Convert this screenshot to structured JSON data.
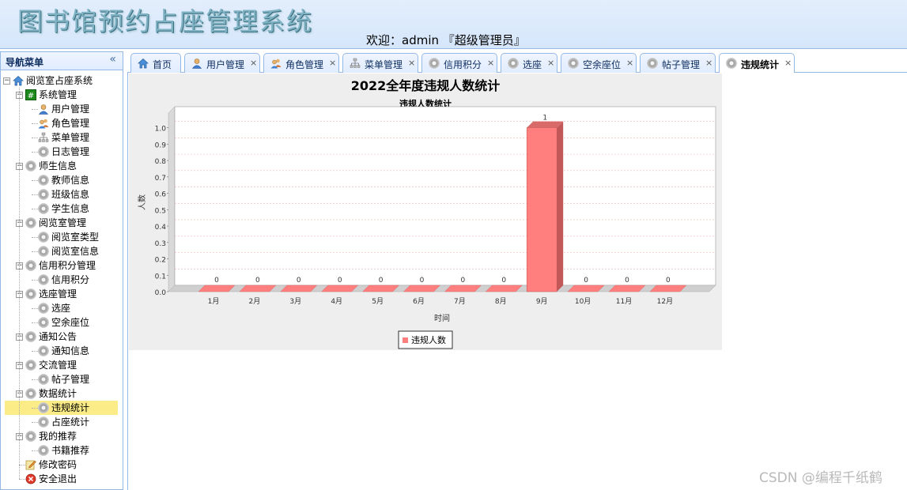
{
  "header": {
    "app_title": "图书馆预约占座管理系统",
    "welcome": "欢迎：admin 『超级管理员』"
  },
  "sidebar": {
    "title": "导航菜单",
    "tree": [
      {
        "label": "阅览室占座系统",
        "level": 0,
        "icon": "home-icon",
        "toggle": "minus"
      },
      {
        "label": "系统管理",
        "level": 1,
        "icon": "grid-icon",
        "toggle": "minus"
      },
      {
        "label": "用户管理",
        "level": 2,
        "icon": "user-icon"
      },
      {
        "label": "角色管理",
        "level": 2,
        "icon": "users-icon"
      },
      {
        "label": "菜单管理",
        "level": 2,
        "icon": "sitemap-icon"
      },
      {
        "label": "日志管理",
        "level": 2,
        "icon": "gear-icon"
      },
      {
        "label": "师生信息",
        "level": 1,
        "icon": "gear-icon",
        "toggle": "minus"
      },
      {
        "label": "教师信息",
        "level": 2,
        "icon": "gear-icon"
      },
      {
        "label": "班级信息",
        "level": 2,
        "icon": "gear-icon"
      },
      {
        "label": "学生信息",
        "level": 2,
        "icon": "gear-icon"
      },
      {
        "label": "阅览室管理",
        "level": 1,
        "icon": "gear-icon",
        "toggle": "minus"
      },
      {
        "label": "阅览室类型",
        "level": 2,
        "icon": "gear-icon"
      },
      {
        "label": "阅览室信息",
        "level": 2,
        "icon": "gear-icon"
      },
      {
        "label": "信用积分管理",
        "level": 1,
        "icon": "gear-icon",
        "toggle": "minus"
      },
      {
        "label": "信用积分",
        "level": 2,
        "icon": "gear-icon"
      },
      {
        "label": "选座管理",
        "level": 1,
        "icon": "gear-icon",
        "toggle": "minus"
      },
      {
        "label": "选座",
        "level": 2,
        "icon": "gear-icon"
      },
      {
        "label": "空余座位",
        "level": 2,
        "icon": "gear-icon"
      },
      {
        "label": "通知公告",
        "level": 1,
        "icon": "gear-icon",
        "toggle": "minus"
      },
      {
        "label": "通知信息",
        "level": 2,
        "icon": "gear-icon"
      },
      {
        "label": "交流管理",
        "level": 1,
        "icon": "gear-icon",
        "toggle": "minus"
      },
      {
        "label": "帖子管理",
        "level": 2,
        "icon": "gear-icon"
      },
      {
        "label": "数据统计",
        "level": 1,
        "icon": "gear-icon",
        "toggle": "minus"
      },
      {
        "label": "违规统计",
        "level": 2,
        "icon": "gear-icon",
        "selected": true
      },
      {
        "label": "占座统计",
        "level": 2,
        "icon": "gear-icon"
      },
      {
        "label": "我的推荐",
        "level": 1,
        "icon": "gear-icon",
        "toggle": "minus"
      },
      {
        "label": "书籍推荐",
        "level": 2,
        "icon": "gear-icon"
      },
      {
        "label": "修改密码",
        "level": 1,
        "icon": "edit-icon"
      },
      {
        "label": "安全退出",
        "level": 1,
        "icon": "exit-icon"
      }
    ]
  },
  "tabs": [
    {
      "label": "首页",
      "icon": "home-icon",
      "closable": false
    },
    {
      "label": "用户管理",
      "icon": "user-icon",
      "closable": true
    },
    {
      "label": "角色管理",
      "icon": "users-icon",
      "closable": true
    },
    {
      "label": "菜单管理",
      "icon": "sitemap-icon",
      "closable": true
    },
    {
      "label": "信用积分",
      "icon": "gear-icon",
      "closable": true
    },
    {
      "label": "选座",
      "icon": "gear-icon",
      "closable": true
    },
    {
      "label": "空余座位",
      "icon": "gear-icon",
      "closable": true
    },
    {
      "label": "帖子管理",
      "icon": "gear-icon",
      "closable": true
    },
    {
      "label": "违规统计",
      "icon": "gear-icon",
      "closable": true,
      "active": true
    }
  ],
  "close_glyph": "×",
  "chart_data": {
    "type": "bar",
    "title": "2022全年度违规人数统计",
    "subtitle": "违规人数统计",
    "xlabel": "时间",
    "ylabel": "人数",
    "categories": [
      "1月",
      "2月",
      "3月",
      "4月",
      "5月",
      "6月",
      "7月",
      "8月",
      "9月",
      "10月",
      "11月",
      "12月"
    ],
    "series": [
      {
        "name": "违规人数",
        "values": [
          0,
          0,
          0,
          0,
          0,
          0,
          0,
          0,
          1,
          0,
          0,
          0
        ]
      }
    ],
    "ylim": [
      0,
      1.0
    ],
    "yticks": [
      "0.0",
      "0.1",
      "0.2",
      "0.3",
      "0.4",
      "0.5",
      "0.6",
      "0.7",
      "0.8",
      "0.9",
      "1.0"
    ],
    "data_labels": [
      "0",
      "0",
      "0",
      "0",
      "0",
      "0",
      "0",
      "0",
      "1",
      "0",
      "0",
      "0"
    ],
    "grid": true,
    "legend_position": "bottom",
    "bar_color": "#ff7f7f"
  },
  "watermark": "CSDN @编程千纸鹤"
}
